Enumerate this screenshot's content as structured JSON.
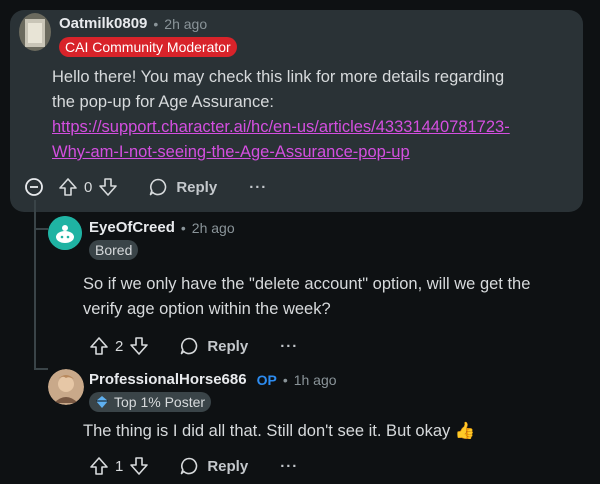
{
  "comments": [
    {
      "username": "Oatmilk0809",
      "time": "2h ago",
      "flair": "CAI Community Moderator",
      "body_line1": "Hello there! You may check this link for more details regarding",
      "body_line2": "the pop-up for Age Assurance:",
      "link_line1": "https://support.character.ai/hc/en-us/articles/43331440781723-",
      "link_line2": "Why-am-I-not-seeing-the-Age-Assurance-pop-up",
      "votes": "0",
      "reply_label": "Reply",
      "more_label": "···"
    },
    {
      "username": "EyeOfCreed",
      "time": "2h ago",
      "flair": "Bored",
      "body_line1": "So if we only have the \"delete account\" option, will we get the",
      "body_line2": "verify age option within the week?",
      "votes": "2",
      "reply_label": "Reply",
      "more_label": "···"
    },
    {
      "username": "ProfessionalHorse686",
      "op_badge": "OP",
      "time": "1h ago",
      "flair": "Top 1% Poster",
      "body_line1": "The thing is I did all that. Still don't see it. But okay 👍",
      "votes": "1",
      "reply_label": "Reply",
      "more_label": "···"
    }
  ],
  "separator": "•",
  "icons": {
    "collapse": "collapse-minus-icon",
    "upvote": "upvote-arrow-icon",
    "downvote": "downvote-arrow-icon",
    "reply": "speech-bubble-icon",
    "poster": "diamond-badge-icon"
  },
  "colors": {
    "background": "#0e1113",
    "card": "#2a3236",
    "mod_flair": "#d8232a",
    "link": "#d44fe0",
    "op": "#2d8cf0"
  }
}
